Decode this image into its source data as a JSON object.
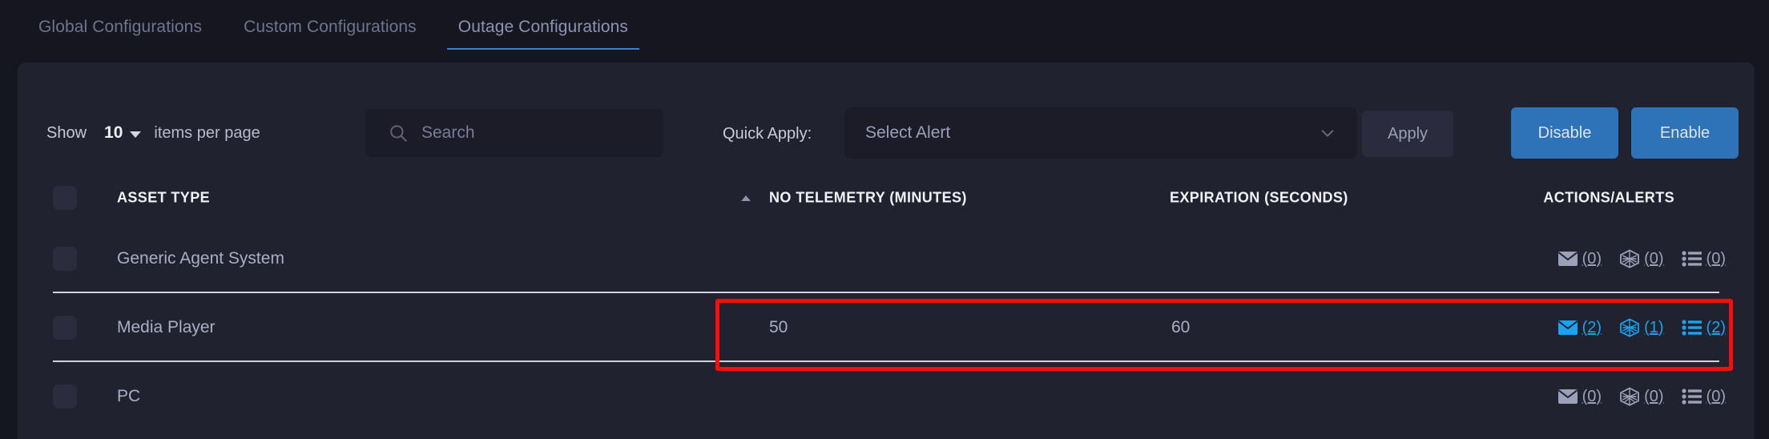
{
  "tabs": [
    {
      "label": "Global Configurations",
      "active": false
    },
    {
      "label": "Custom Configurations",
      "active": false
    },
    {
      "label": "Outage Configurations",
      "active": true
    }
  ],
  "toolbar": {
    "show_label": "Show",
    "page_size": "10",
    "items_per_page_label": "items per page",
    "search_placeholder": "Search",
    "search_value": "",
    "quick_apply_label": "Quick Apply:",
    "alert_select_value": "Select Alert",
    "apply_label": "Apply",
    "disable_label": "Disable",
    "enable_label": "Enable"
  },
  "table": {
    "headers": {
      "asset_type": "ASSET TYPE",
      "no_telemetry": "NO TELEMETRY (MINUTES)",
      "expiration": "EXPIRATION (SECONDS)",
      "actions": "ACTIONS/ALERTS"
    },
    "sort": {
      "column": "asset_type",
      "direction": "asc"
    },
    "rows": [
      {
        "asset_type": "Generic Agent System",
        "no_telemetry": "",
        "expiration": "",
        "email_count": "(0)",
        "webhook_count": "(0)",
        "list_count": "(0)",
        "highlighted": false
      },
      {
        "asset_type": "Media Player",
        "no_telemetry": "50",
        "expiration": "60",
        "email_count": "(2)",
        "webhook_count": "(1)",
        "list_count": "(2)",
        "highlighted": true
      },
      {
        "asset_type": "PC",
        "no_telemetry": "",
        "expiration": "",
        "email_count": "(0)",
        "webhook_count": "(0)",
        "list_count": "(0)",
        "highlighted": false
      }
    ]
  },
  "colors": {
    "page_background": "#15161f",
    "card_background": "#212230",
    "accent_blue": "#2e72b8",
    "active_icon_blue": "#18a4f0",
    "highlight_red": "#fb0d0d",
    "tab_underline": "#3b82cc"
  }
}
